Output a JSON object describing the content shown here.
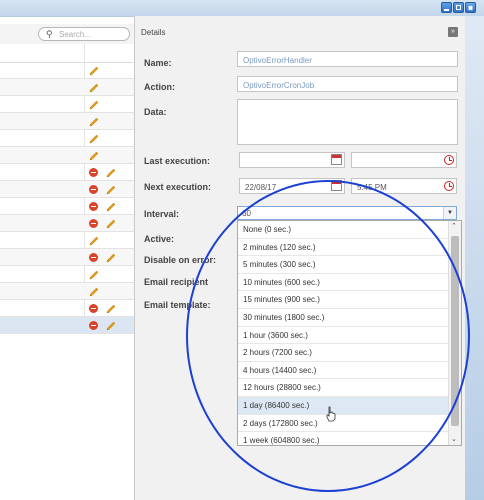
{
  "search": {
    "placeholder": "Search..."
  },
  "list": {
    "rows": [
      {
        "delete": false
      },
      {
        "delete": false
      },
      {
        "delete": false
      },
      {
        "delete": false
      },
      {
        "delete": false
      },
      {
        "delete": false
      },
      {
        "delete": true
      },
      {
        "delete": true
      },
      {
        "delete": true
      },
      {
        "delete": true
      },
      {
        "delete": false
      },
      {
        "delete": true
      },
      {
        "delete": false
      },
      {
        "delete": false
      },
      {
        "delete": true
      },
      {
        "delete": true
      }
    ]
  },
  "details": {
    "title": "Details",
    "labels": {
      "name": "Name:",
      "action": "Action:",
      "data": "Data:",
      "last_execution": "Last execution:",
      "next_execution": "Next execution:",
      "interval": "Interval:",
      "active": "Active:",
      "disable_on_error": "Disable on error:",
      "email_recipient": "Email recipient",
      "email_template": "Email template:"
    },
    "values": {
      "name": "OptivoErrorHandler",
      "action": "OptivoErrorCronJob",
      "data": "",
      "last_execution_date": "",
      "last_execution_time": "",
      "next_execution_date": "22/08/17",
      "next_execution_time": "5:45 PM",
      "interval": "60"
    }
  },
  "interval_options": [
    "None (0 sec.)",
    "2 minutes (120 sec.)",
    "5 minutes (300 sec.)",
    "10 minutes (600 sec.)",
    "15 minutes (900 sec.)",
    "30 minutes (1800 sec.)",
    "1 hour (3600 sec.)",
    "2 hours (7200 sec.)",
    "4 hours (14400 sec.)",
    "12 hours (28800 sec.)",
    "1 day (86400 sec.)",
    "2 days (172800 sec.)",
    "1 week (604800 sec.)"
  ],
  "highlighted_option": "1 day (86400 sec.)",
  "colors": {
    "accent": "#1c3fd4",
    "delete": "#d8432b",
    "edit": "#e8a319"
  }
}
